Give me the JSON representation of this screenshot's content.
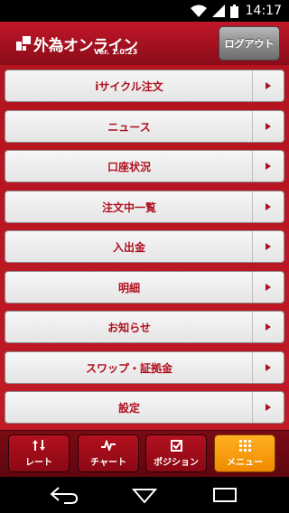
{
  "status_bar": {
    "time": "14:17",
    "icons": [
      "wifi-icon",
      "signal-icon",
      "battery-icon"
    ]
  },
  "header": {
    "logo_text": "外為オンライン",
    "version": "Ver. 1.0.23",
    "logout_label": "ログアウト"
  },
  "menu": {
    "items": [
      {
        "label": "iサイクル注文"
      },
      {
        "label": "ニュース"
      },
      {
        "label": "口座状況"
      },
      {
        "label": "注文中一覧"
      },
      {
        "label": "入出金"
      },
      {
        "label": "明細"
      },
      {
        "label": "お知らせ"
      },
      {
        "label": "スワップ・証拠金"
      },
      {
        "label": "設定"
      }
    ]
  },
  "tabs": [
    {
      "label": "レート",
      "icon": "rate-arrows-icon",
      "active": false
    },
    {
      "label": "チャート",
      "icon": "chart-icon",
      "active": false
    },
    {
      "label": "ポジション",
      "icon": "position-check-icon",
      "active": false
    },
    {
      "label": "メニュー",
      "icon": "menu-grid-icon",
      "active": true
    }
  ],
  "navigation": {
    "buttons": [
      "back-icon",
      "home-icon",
      "recent-apps-icon"
    ]
  },
  "colors": {
    "brand_red": "#b3141f",
    "menu_text": "#b00f1e",
    "active_tab": "#f59a10"
  }
}
